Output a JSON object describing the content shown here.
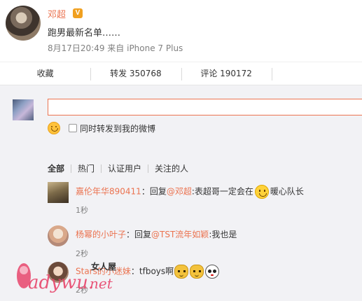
{
  "post": {
    "author": "邓超",
    "vip_badge": "V",
    "text": "跑男最新名单……",
    "meta": "8月17日20:49 来自 iPhone 7 Plus"
  },
  "actions": {
    "favorite": "收藏",
    "repost": "转发 350768",
    "comment": "评论 190172"
  },
  "composer": {
    "input_value": "",
    "repost_checkbox_label": "同时转发到我的微博",
    "repost_checked": false
  },
  "filter_tabs": [
    "全部",
    "热门",
    "认证用户",
    "关注的人"
  ],
  "comments": [
    {
      "user": "嘉伦年华890411",
      "prefix": "：回复",
      "mention": "@邓超",
      "text_before": ":表超哥一定会在",
      "text_after": "暖心队长",
      "time": "1秒"
    },
    {
      "user": "杨幂的小叶子",
      "prefix": "：回复",
      "mention": "@TST流年如颖",
      "text_before": ":我也是",
      "text_after": "",
      "time": "2秒"
    },
    {
      "user": "Stars的小迷妹",
      "prefix": "：",
      "mention": "",
      "text_before": "tfboys啊",
      "text_after": "",
      "time": "2秒"
    }
  ],
  "watermark": {
    "text": "ladywu.net",
    "label": "女人屋"
  },
  "colors": {
    "accent": "#eb7350",
    "background": "#f2f2f5",
    "meta_text": "#808080"
  }
}
